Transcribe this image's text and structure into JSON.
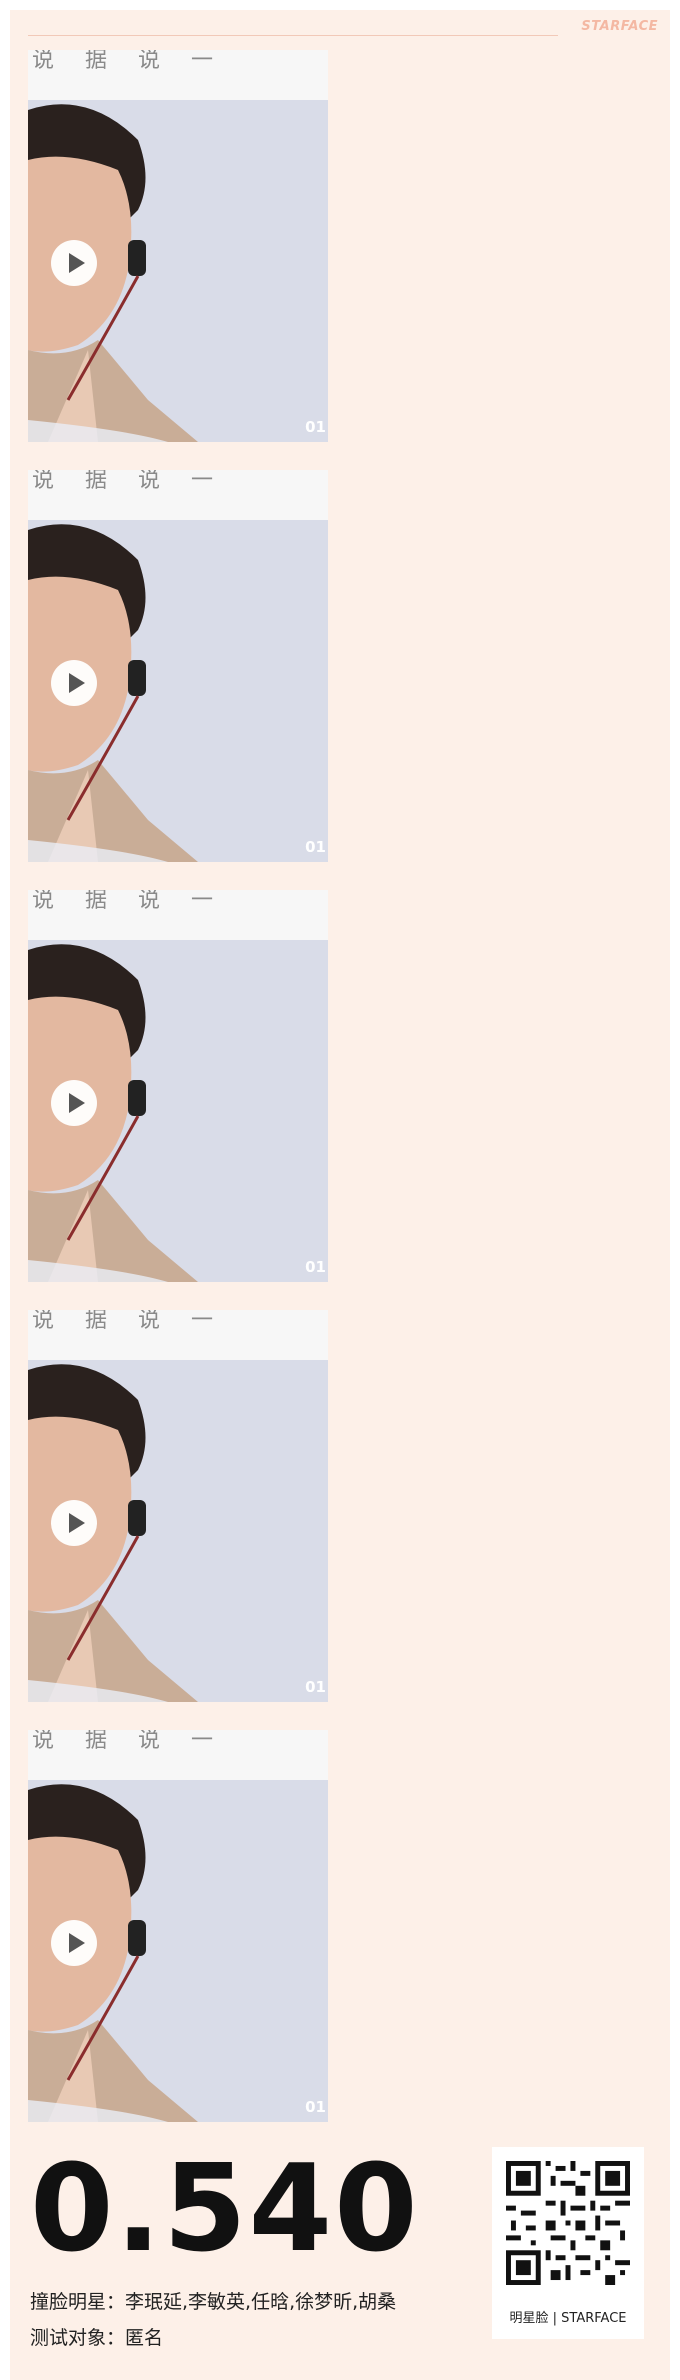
{
  "header": {
    "brand": "STARFACE"
  },
  "video_frames": [
    {
      "frame_label": "01",
      "overlay_text": "说 据 说 一"
    },
    {
      "frame_label": "01",
      "overlay_text": "说 据 说 一"
    },
    {
      "frame_label": "01",
      "overlay_text": "说 据 说 一"
    },
    {
      "frame_label": "01",
      "overlay_text": "说 据 说 一"
    },
    {
      "frame_label": "01",
      "overlay_text": "说 据 说 一"
    }
  ],
  "result": {
    "score": "0.540",
    "match_line": "撞脸明星：李珉延,李敏英,任晗,徐梦昕,胡桑",
    "subject_line": "测试对象：匿名"
  },
  "qr": {
    "caption": "明星脸 | STARFACE"
  }
}
